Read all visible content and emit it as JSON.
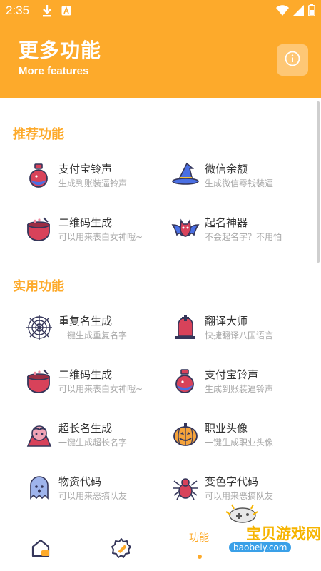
{
  "status_bar": {
    "time": "2:35"
  },
  "header": {
    "title": "更多功能",
    "subtitle": "More features"
  },
  "sections": [
    {
      "title": "推荐功能",
      "items": [
        {
          "name": "支付宝铃声",
          "desc": "生成到账装逼铃声",
          "icon": "potion-icon"
        },
        {
          "name": "微信余额",
          "desc": "生成微信零钱装逼",
          "icon": "witch-hat-icon"
        },
        {
          "name": "二维码生成",
          "desc": "可以用来表白女神哦~",
          "icon": "cauldron-icon"
        },
        {
          "name": "起名神器",
          "desc": "不会起名字？不用怕",
          "icon": "bat-icon"
        }
      ]
    },
    {
      "title": "实用功能",
      "items": [
        {
          "name": "重复名生成",
          "desc": "一键生成重复名字",
          "icon": "spider-web-icon"
        },
        {
          "name": "翻译大师",
          "desc": "快捷翻译八国语言",
          "icon": "tombstone-icon"
        },
        {
          "name": "二维码生成",
          "desc": "可以用来表白女神哦~",
          "icon": "cauldron-icon"
        },
        {
          "name": "支付宝铃声",
          "desc": "生成到账装逼铃声",
          "icon": "potion-icon"
        },
        {
          "name": "超长名生成",
          "desc": "一键生成超长名字",
          "icon": "vampire-icon"
        },
        {
          "name": "职业头像",
          "desc": "一键生成职业头像",
          "icon": "pumpkin-icon"
        },
        {
          "name": "物资代码",
          "desc": "可以用来恶搞队友",
          "icon": "ghost-icon"
        },
        {
          "name": "变色字代码",
          "desc": "可以用来恶搞队友",
          "icon": "spider-icon"
        }
      ]
    }
  ],
  "bottom_nav": {
    "active_label": "功能"
  },
  "watermark": {
    "text": "宝贝游戏网",
    "url": "baobeiy.com"
  },
  "colors": {
    "accent": "#FDAA2B",
    "text": "#333333",
    "subtext": "#a8a8a8"
  }
}
